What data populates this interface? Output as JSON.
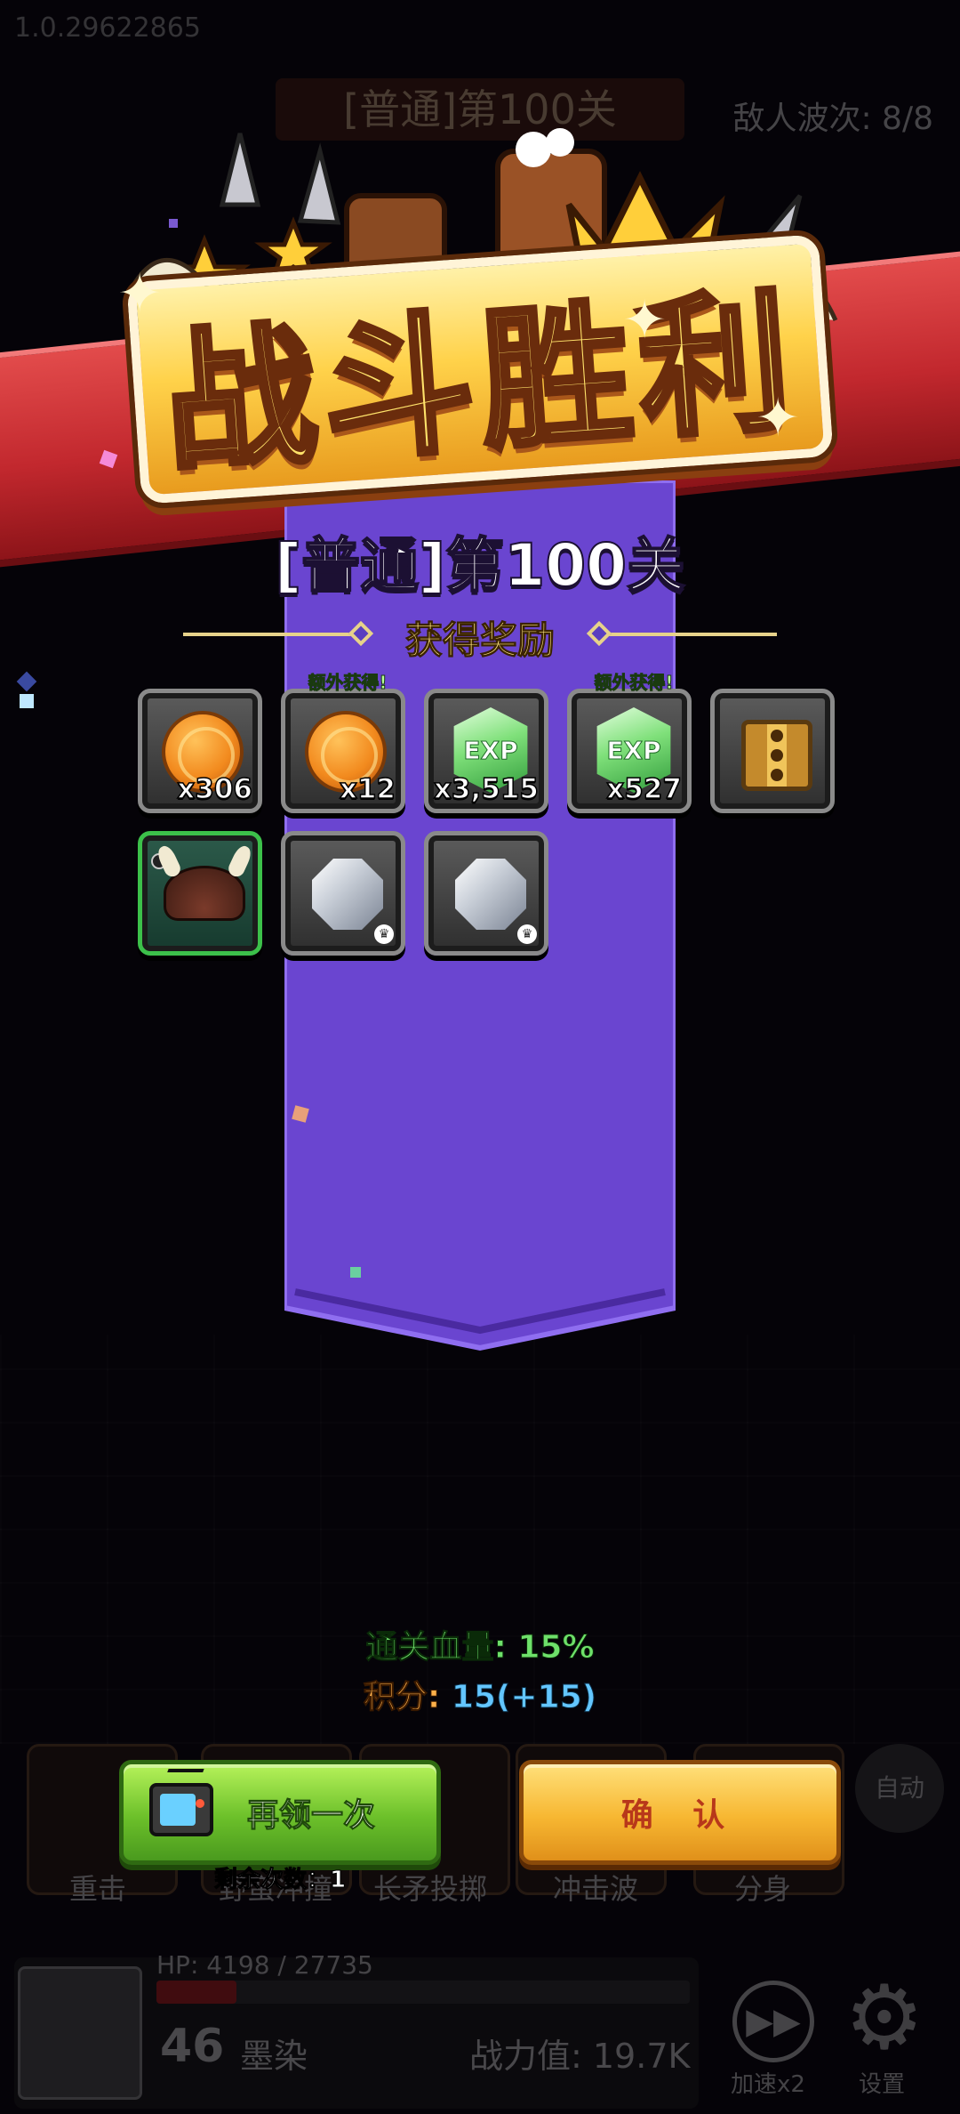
{
  "version": "1.0.29622865",
  "background_hud": {
    "stage_title": "[普通]第100关",
    "wave_text": "敌人波次: 8/8",
    "skills": [
      "重击",
      "野蛮冲撞",
      "长矛投掷",
      "冲击波",
      "分身"
    ],
    "auto_label": "自动",
    "hp_text": "HP: 4198 / 27735",
    "hp_fraction": 0.15,
    "level": "46",
    "player_name": "墨染",
    "power_text": "战力值: 19.7K",
    "speed_label": "加速x2",
    "settings_label": "设置"
  },
  "victory": {
    "title": "战斗胜利",
    "stage_title": "[普通]第100关",
    "reward_header": "获得奖励",
    "bonus_tag": "额外获得!",
    "rewards_row1": [
      {
        "icon": "gold-coin-icon",
        "qty": "x306",
        "bonus": false
      },
      {
        "icon": "gold-coin-icon",
        "qty": "x12",
        "bonus": true
      },
      {
        "icon": "exp-gem-icon",
        "qty": "x3,515",
        "bonus": false,
        "label": "EXP"
      },
      {
        "icon": "exp-gem-icon",
        "qty": "x527",
        "bonus": true,
        "label": "EXP"
      },
      {
        "icon": "treasure-box-icon",
        "qty": "",
        "bonus": false
      }
    ],
    "rewards_row2": [
      {
        "icon": "viking-helmet-icon",
        "qty": "",
        "rarity": "green"
      },
      {
        "icon": "silver-crystal-icon",
        "qty": ""
      },
      {
        "icon": "silver-crystal-icon",
        "qty": ""
      }
    ],
    "clear_hp": "通关血量: 15%",
    "score_label": "积分: ",
    "score_value": "15(+15)",
    "retry_button": "再领一次",
    "remaining_text": "剩余次数：1",
    "confirm_button": "确 认"
  },
  "colors": {
    "ribbon": "#c2282e",
    "banner": "#6a45d0",
    "retry_green": "#6cc02a",
    "confirm_gold": "#f7b732",
    "hp_green": "#6ee06a",
    "score_blue": "#63c6ff"
  }
}
